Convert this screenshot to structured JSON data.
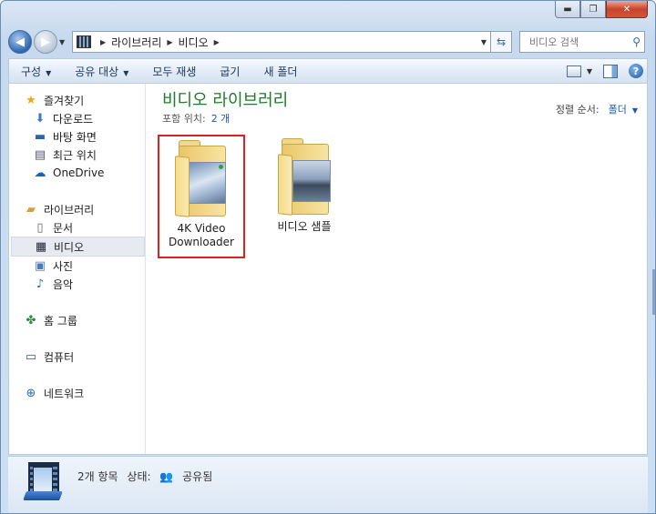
{
  "window": {
    "caption": {
      "min": "▬",
      "max": "❐",
      "close": "✕"
    }
  },
  "address": {
    "crumbs": [
      "라이브러리",
      "비디오"
    ],
    "search_placeholder": "비디오 검색"
  },
  "toolbar": {
    "commands": [
      "구성",
      "공유 대상",
      "모두 재생",
      "굽기",
      "새 폴더"
    ]
  },
  "sidebar": {
    "favorites_header": "즐겨찾기",
    "favorites": [
      "다운로드",
      "바탕 화면",
      "최근 위치",
      "OneDrive"
    ],
    "libraries_header": "라이브러리",
    "libraries": [
      "문서",
      "비디오",
      "사진",
      "음악"
    ],
    "homegroup": "홈 그룹",
    "computer": "컴퓨터",
    "network": "네트워크"
  },
  "main": {
    "title": "비디오 라이브러리",
    "includes_label": "포함 위치:",
    "includes_value": "2 개",
    "sort_label": "정렬 순서:",
    "sort_value": "폴더",
    "items": [
      {
        "label_line1": "4K Video",
        "label_line2": "Downloader"
      },
      {
        "label_line1": "비디오 샘플",
        "label_line2": ""
      }
    ]
  },
  "status": {
    "count": "2개 항목",
    "state_label": "상태:",
    "state_value": "공유됨"
  },
  "colors": {
    "title_green": "#1f7b2a",
    "link_blue": "#1a58b4",
    "selection_red": "#e02020"
  }
}
